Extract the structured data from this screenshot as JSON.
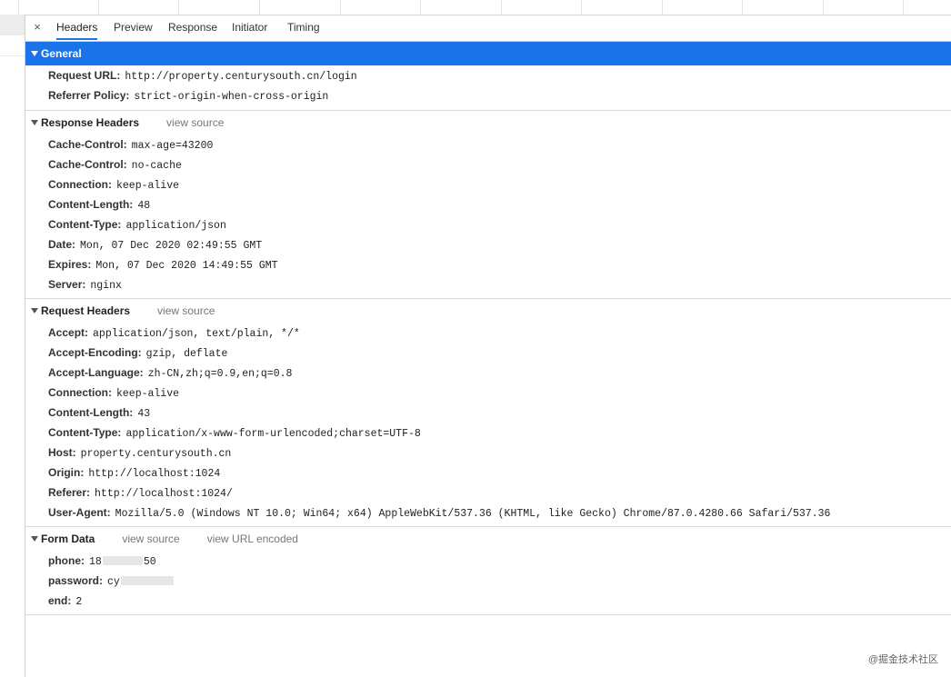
{
  "tabs": [
    {
      "label": "Headers",
      "active": true
    },
    {
      "label": "Preview",
      "active": false
    },
    {
      "label": "Response",
      "active": false
    },
    {
      "label": "Initiator",
      "active": false
    },
    {
      "label": "Timing",
      "active": false
    }
  ],
  "close_symbol": "×",
  "general": {
    "title": "General",
    "rows": [
      {
        "name": "Request URL:",
        "value": "http://property.centurysouth.cn/login"
      },
      {
        "name": "Referrer Policy:",
        "value": "strict-origin-when-cross-origin"
      }
    ]
  },
  "response_headers": {
    "title": "Response Headers",
    "view_source": "view source",
    "rows": [
      {
        "name": "Cache-Control:",
        "value": "max-age=43200"
      },
      {
        "name": "Cache-Control:",
        "value": "no-cache"
      },
      {
        "name": "Connection:",
        "value": "keep-alive"
      },
      {
        "name": "Content-Length:",
        "value": "48"
      },
      {
        "name": "Content-Type:",
        "value": "application/json"
      },
      {
        "name": "Date:",
        "value": "Mon, 07 Dec 2020 02:49:55 GMT"
      },
      {
        "name": "Expires:",
        "value": "Mon, 07 Dec 2020 14:49:55 GMT"
      },
      {
        "name": "Server:",
        "value": "nginx"
      }
    ]
  },
  "request_headers": {
    "title": "Request Headers",
    "view_source": "view source",
    "rows": [
      {
        "name": "Accept:",
        "value": "application/json, text/plain, */*"
      },
      {
        "name": "Accept-Encoding:",
        "value": "gzip, deflate"
      },
      {
        "name": "Accept-Language:",
        "value": "zh-CN,zh;q=0.9,en;q=0.8"
      },
      {
        "name": "Connection:",
        "value": "keep-alive"
      },
      {
        "name": "Content-Length:",
        "value": "43"
      },
      {
        "name": "Content-Type:",
        "value": "application/x-www-form-urlencoded;charset=UTF-8"
      },
      {
        "name": "Host:",
        "value": "property.centurysouth.cn"
      },
      {
        "name": "Origin:",
        "value": "http://localhost:1024"
      },
      {
        "name": "Referer:",
        "value": "http://localhost:1024/"
      },
      {
        "name": "User-Agent:",
        "value": "Mozilla/5.0 (Windows NT 10.0; Win64; x64) AppleWebKit/537.36 (KHTML, like Gecko) Chrome/87.0.4280.66 Safari/537.36"
      }
    ]
  },
  "form_data": {
    "title": "Form Data",
    "view_source": "view source",
    "view_url_encoded": "view URL encoded",
    "phone": {
      "name": "phone:",
      "value_start": "18",
      "value_end": "50"
    },
    "password": {
      "name": "password:",
      "value_start": "cy"
    },
    "end": {
      "name": "end:",
      "value": "2"
    }
  },
  "watermark": "@掘金技术社区",
  "colors": {
    "accent": "#1a73e8"
  }
}
